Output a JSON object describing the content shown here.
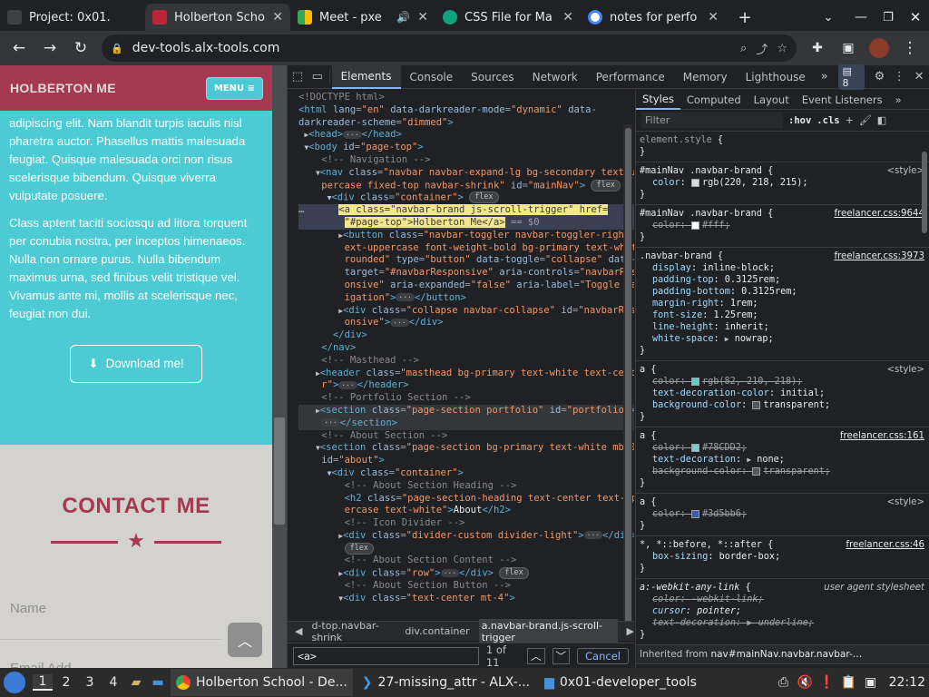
{
  "browser": {
    "tabs": [
      {
        "title": "Project: 0x01.",
        "active": false,
        "audio": false
      },
      {
        "title": "Holberton Scho",
        "active": true,
        "audio": false
      },
      {
        "title": "Meet - pxe",
        "active": false,
        "audio": true
      },
      {
        "title": "CSS File for Ma",
        "active": false,
        "audio": false
      },
      {
        "title": "notes for perfo",
        "active": false,
        "audio": false
      }
    ],
    "url": "dev-tools.alx-tools.com"
  },
  "page": {
    "brand": "HOLBERTON ME",
    "menu_label": "MENU ≡",
    "about_p1": "adipiscing elit. Nam blandit turpis iaculis nisl pharetra auctor. Phasellus mattis malesuada feugiat. Quisque malesuada orci non risus scelerisque bibendum. Quisque viverra vulputate posuere.",
    "about_p2": "Class aptent taciti sociosqu ad litora torquent per conubia nostra, per inceptos himenaeos. Nulla non ornare purus. Nulla bibendum maximus urna, sed finibus velit tristique vel. Vivamus ante mi, mollis at scelerisque nec, feugiat non dui.",
    "download_label": "Download me!",
    "contact_title": "CONTACT ME",
    "name_placeholder": "Name",
    "email_placeholder": "Email Add"
  },
  "devtools": {
    "tabs": [
      "Elements",
      "Console",
      "Sources",
      "Network",
      "Performance",
      "Memory",
      "Lighthouse"
    ],
    "issues_count": "8",
    "breadcrumbs": [
      "d-top.navbar-shrink",
      "div.container",
      "a.navbar-brand.js-scroll-trigger"
    ],
    "search": {
      "query": "<a>",
      "count": "1 of 11",
      "cancel": "Cancel"
    },
    "styles_tabs": [
      "Styles",
      "Computed",
      "Layout",
      "Event Listeners"
    ],
    "filter_placeholder": "Filter",
    "hov": ":hov",
    "cls": ".cls",
    "dom_selected_note": "== $0",
    "inherited_from_label": "Inherited from",
    "inherited_from_selector": "nav#mainNav.navbar.navbar-…"
  },
  "taskbar": {
    "workspaces": [
      "1",
      "2",
      "3",
      "4"
    ],
    "tasks": [
      {
        "title": "Holberton School - De...",
        "active": true
      },
      {
        "title": "27-missing_attr - ALX-...",
        "active": false
      },
      {
        "title": "0x01-developer_tools",
        "active": false
      }
    ],
    "clock": "22:12"
  },
  "colors": {
    "navbar": "#a5394f",
    "about_bg": "#4ccbd4",
    "contact_bg": "#d3d2ce",
    "accent": "#8ab4f8"
  }
}
